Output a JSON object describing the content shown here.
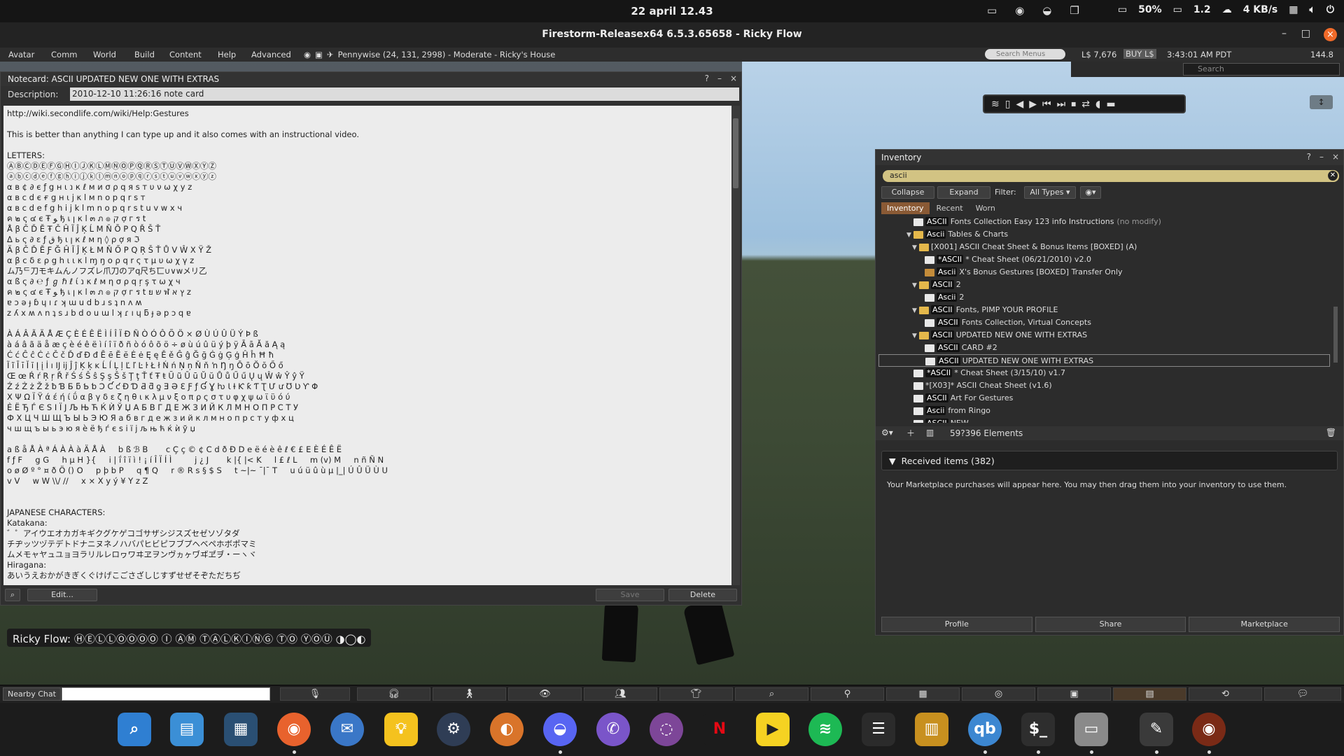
{
  "system_bar": {
    "clock": "22 april  12.43",
    "battery": "50%",
    "load": "1.2",
    "network": "4 KB/s"
  },
  "window": {
    "title": "Firestorm-Releasex64 6.5.3.65658 - Ricky Flow",
    "minimize": "–",
    "maximize": "□",
    "close": "×"
  },
  "menubar": {
    "items": [
      "Avatar",
      "Comm",
      "World",
      "Build",
      "Content",
      "Help",
      "Advanced"
    ],
    "location": "Pennywise (24, 131, 2998) - Moderate - Ricky's House",
    "search_placeholder": "Search Menus",
    "balance": "L$ 7,676",
    "buy": "BUY L$",
    "time": "3:43:01 AM PDT",
    "fps": "144.8"
  },
  "favbar": {
    "search_placeholder": "Search"
  },
  "notecard": {
    "title": "Notecard: ASCII UPDATED NEW ONE WITH EXTRAS",
    "description_label": "Description:",
    "description": "2010-12-10 11:26:16 note card",
    "help": "?",
    "minimize": "–",
    "close": "×",
    "text": "http://wiki.secondlife.com/wiki/Help:Gestures\n\nThis is better than anything I can type up and it also comes with an instructional video.\n\nLETTERS:\nⒶⒷⒸⒹⒺⒻⒼⒽⒾⒿⓀⓁⓂⓃⓄⓅⓆⓇⓈⓉⓊⓋⓌⓍⓎⓏ\nⓐⓑⓒⓓⓔⓕⓖⓗⓘⓙⓚⓛⓜⓝⓞⓟⓠⓡⓢⓣⓤⓥⓦⓧⓨⓩ\nα в ¢ ∂ є ƒ g н ι נ к ℓ м и σ ρ q я ѕ т υ ν ω χ у z\nα в c d є ғ g н ι j κ l м n o p q r s т\nα в c d e f g h i j k l m n o p q r s t u v w x ч\nค ๒ ς ๔ є Ŧ ﻮ ђ เ ן к l ๓ ภ ๏ ק ợ г ร t\nÅ β Č Ď Ĕ Ŧ Č Ĥ Ĩ Ĵ Ķ Ĺ M Ň Ō P Q Ř Š Ť\nΔ ь ς ∂ ε ƒ ق ђ ι ן к ℓ м η ◊ ρ ợ я ℑ\nÄ β Č Ď Ĕ Ƒ Ğ Ĥ Ĩ Ĵ Ķ Ł M Ň Ő P Q Ŗ Š Ť Ů V Ŵ X Ÿ Ž\nα β c δ ε ρ g h ι ι κ l ɱ ŋ ο ρ q r ς τ μ υ ω χ γ z\nム乃ᄃ刀モキムんノフズレ爪刀のアq尺ち匸∪∨wメリ乙\nα ß ς ∂ ℮ ƒ ℊ ℏ ℓ ί נ κ ℓ м η σ ρ q ŗ ş τ ω χ ч\nค ๒ ς ๔ є Ŧ ﻮ ђ เ ן к l ๓ ภ ๏ ק ợ г ร t ย ש ฬ ץ א z\nɐ ɔ ǝ ɟ ɓ ɥ ı ɾ ʞ ɯ u d b ɹ s ʇ n ʌ ʍ\nz ʎ x ʍ ʌ n ʇ s ɹ b d o u ɯ l ʞ ɾ ı ɥ ƃ ɟ ə p ɔ q ɐ\n\nÀ Á Â Ã Ä Å Æ Ç È É Ê Ë Ì Í Î Ï Ð Ñ Ò Ó Ô Õ Ö × Ø Ù Ú Û Ü Ý Þ ß\nà á â ã ä å æ ç è é ê ë ì í î ï ð ñ ò ó ô õ ö ÷ ø ù ú û ü ý þ ÿ Ā ā Ă ă Ą ą\nĆ ć Ĉ ĉ Ċ ċ Č č Ď ď Đ đ Ē ē Ĕ ĕ Ė ė Ę ę Ě ě Ĝ ĝ Ğ ğ Ġ ġ Ģ ģ Ĥ ĥ Ħ ħ\nĨ ĩ Ī ī Ĭ ĭ Į į İ ı Ĳ ĳ Ĵ ĵ Ķ ķ ĸ Ĺ ĺ Ļ ļ Ľ ľ Ŀ ŀ Ł ł Ń ń Ņ ņ Ň ň ŉ Ŋ ŋ Ō ō Ŏ ŏ Ő ő\nŒ œ Ŕ ŕ Ŗ ŗ Ř ř Ś ś Ŝ ŝ Ş ş Š š Ţ ţ Ť ť Ŧ ŧ Ũ ũ Ū ū Ŭ ŭ Ů ů Ű ű Ų ų Ŵ ŵ Ŷ ŷ Ÿ\nŹ ź Ż ż Ž ž ƀ Ɓ Ƃ ƃ Ƅ ƅ Ɔ Ƈ ƈ Ɖ Ɗ Ƌ ƌ ƍ Ǝ Ə Ɛ Ƒ ƒ Ɠ Ɣ ƕ Ɩ Ɨ Ƙ ƙ Ƭ Ʈ Ư ư Ʊ Ʋ Ƴ Φ\nΧ Ψ Ω Ϊ Ϋ ά έ ή ί ΰ α β γ δ ε ζ η θ ι κ λ μ ν ξ ο π ρ ς σ τ υ φ χ ψ ω ϊ ϋ ό ύ\nЀ Ё Ђ Ѓ Є Ѕ І Ї Ј Љ Њ Ћ Ќ Ѝ Ў Џ А Б В Г Д Е Ж З И Й К Л М Н О П Р С Т У\nФ Х Ц Ч Ш Щ Ъ Ы Ь Э Ю Я а б в г д е ж з и й к л м н о п р с т у ф х ц\nч ш щ ъ ы ь э ю я ѐ ё ђ ѓ є ѕ і ї ј љ њ ћ ќ ѝ ў џ\n\na ß å Å À ª Á À À à Ä Å À     b ß ℬ B       c Ç ç © ¢ C d ð Đ D e ë é è ê ℓ € £ E È É Ê Ë\nf ƒ F     g G     h μ H }{     i | ḯ î ï ì ! ¡ í Î Ï Í Ì         j ¿ J       k |{ |< K     l £ ℓ L     m (v) M     n ñ Ñ N\no ø Ø º ° ¤ ð Ö () O     p þ b P     q ¶ Q     r ® R s § $ S     t ~|~ ˉ|ˉ T     u ú ü û ù µ |_| Ú Û Ü Ù U\nv V     w W \\\\/ //     x × X y ý ¥ Y z Z\n\n\nJAPANESE CHARACTERS:\nKatakana:\n゛゜アイウエオカガキギクグケゲコゴサザシジスズセゼソゾタダ\nチヂッツヅテデトドナニヌネノハバパヒビピフブプヘベペホボポマミ\nムメモャヤュユョヨラリルレロヮワヰヱヲンヴヵヶヷヸヹヺ・ーヽヾ\nHiragana:\nあいうえおかがきぎくぐけげこごさざしじすずせぜそぞただちぢ",
    "buttons": {
      "edit": "Edit...",
      "save": "Save",
      "delete": "Delete"
    }
  },
  "speech": "Ricky Flow: ⒽⒺⓁⓁⓄⓄⓄⓄ Ⓘ ⒶⓂ ⓉⒶⓁⓀⒾⓃⒼ ⓉⓄ ⓎⓄⓊ ◑◯◐",
  "inventory": {
    "title": "Inventory",
    "help": "?",
    "minimize": "–",
    "close": "×",
    "filter_text": "ascii",
    "collapse": "Collapse",
    "expand": "Expand",
    "filter_label": "Filter:",
    "filter_value": "All Types",
    "tabs": [
      "Inventory",
      "Recent",
      "Worn"
    ],
    "items": [
      {
        "indent": 0,
        "arrow": "",
        "icon": "nc",
        "tag": "ASCII",
        "label": "Fonts Collection Easy 123 info Instructions",
        "muted": "(no modify)"
      },
      {
        "indent": 0,
        "arrow": "▼",
        "icon": "fd",
        "tag": "Ascii",
        "label": "Tables & Charts",
        "muted": ""
      },
      {
        "indent": 1,
        "arrow": "▼",
        "icon": "fd",
        "tag": "",
        "label": "[X001] ASCII Cheat Sheet & Bonus Items [BOXED] (A)",
        "muted": ""
      },
      {
        "indent": 2,
        "arrow": "",
        "icon": "nc",
        "tag": "*ASCII",
        "label": "* Cheat Sheet (06/21/2010) v2.0",
        "muted": ""
      },
      {
        "indent": 2,
        "arrow": "",
        "icon": "bx",
        "tag": "Ascii",
        "label": "X's Bonus Gestures [BOXED] Transfer Only",
        "muted": ""
      },
      {
        "indent": 1,
        "arrow": "▼",
        "icon": "fd",
        "tag": "ASCII",
        "label": "2",
        "muted": ""
      },
      {
        "indent": 2,
        "arrow": "",
        "icon": "nc",
        "tag": "Ascii",
        "label": "2",
        "muted": ""
      },
      {
        "indent": 1,
        "arrow": "▼",
        "icon": "fd",
        "tag": "ASCII",
        "label": "Fonts, PIMP YOUR PROFILE",
        "muted": ""
      },
      {
        "indent": 2,
        "arrow": "",
        "icon": "nc",
        "tag": "ASCII",
        "label": "Fonts Collection, Virtual Concepts",
        "muted": ""
      },
      {
        "indent": 1,
        "arrow": "▼",
        "icon": "fd",
        "tag": "ASCII",
        "label": "UPDATED NEW ONE WITH EXTRAS",
        "muted": ""
      },
      {
        "indent": 2,
        "arrow": "",
        "icon": "nc",
        "tag": "ASCII",
        "label": "CARD #2",
        "muted": ""
      },
      {
        "indent": 2,
        "arrow": "",
        "icon": "nc",
        "tag": "ASCII",
        "label": "UPDATED NEW ONE WITH EXTRAS",
        "muted": "",
        "selected": true
      },
      {
        "indent": 0,
        "arrow": "",
        "icon": "nc",
        "tag": "*ASCII",
        "label": "* Cheat Sheet (3/15/10) v1.7",
        "muted": ""
      },
      {
        "indent": 0,
        "arrow": "",
        "icon": "nc",
        "tag": "",
        "label": "*[X03]* ASCII Cheat Sheet (v1.6)",
        "muted": ""
      },
      {
        "indent": 0,
        "arrow": "",
        "icon": "nc",
        "tag": "ASCII",
        "label": "Art For Gestures",
        "muted": ""
      },
      {
        "indent": 0,
        "arrow": "",
        "icon": "nc",
        "tag": "Ascii",
        "label": "from Ringo",
        "muted": ""
      },
      {
        "indent": 0,
        "arrow": "",
        "icon": "nc",
        "tag": "ASCII",
        "label": "NEW",
        "muted": ""
      }
    ],
    "element_count": "59?396 Elements",
    "received": "Received items (382)",
    "marketplace_note": "Your Marketplace purchases will appear here. You may then drag them into your inventory to use them.",
    "bottom_buttons": [
      "Profile",
      "Share",
      "Marketplace"
    ]
  },
  "chat": {
    "nearby_label": "Nearby Chat"
  },
  "dock": {
    "apps": [
      "search",
      "files",
      "apps-grid",
      "firefox",
      "thunderbird",
      "idea",
      "steam",
      "blender",
      "discord",
      "viber",
      "tor",
      "netflix",
      "player",
      "spotify",
      "tasks",
      "notes",
      "qbittorrent",
      "terminal",
      "file-manager",
      "editor",
      "firestorm"
    ]
  }
}
